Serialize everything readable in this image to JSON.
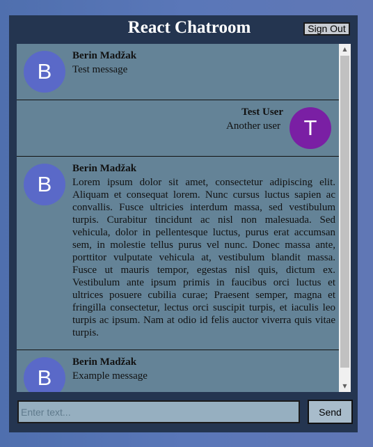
{
  "header": {
    "title": "React Chatroom",
    "signout_label": "Sign Out"
  },
  "messages": [
    {
      "initial": "B",
      "name": "Berin Madžak",
      "text": "Test message",
      "avatar_color": "#5a69c8",
      "side": "left"
    },
    {
      "initial": "T",
      "name": "Test User",
      "text": "Another user",
      "avatar_color": "#7a1fa4",
      "side": "right"
    },
    {
      "initial": "B",
      "name": "Berin Madžak",
      "text": "Lorem ipsum dolor sit amet, consectetur adipiscing elit. Aliquam et consequat lorem. Nunc cursus luctus sapien ac convallis. Fusce ultricies interdum massa, sed vestibulum turpis. Curabitur tincidunt ac nisl non malesuada. Sed vehicula, dolor in pellentesque luctus, purus erat accumsan sem, in molestie tellus purus vel nunc. Donec massa ante, porttitor vulputate vehicula at, vestibulum blandit massa. Fusce ut mauris tempor, egestas nisl quis, dictum ex. Vestibulum ante ipsum primis in faucibus orci luctus et ultrices posuere cubilia curae; Praesent semper, magna et fringilla consectetur, lectus orci suscipit turpis, et iaculis leo turpis ac ipsum. Nam at odio id felis auctor viverra quis vitae turpis.",
      "avatar_color": "#5a69c8",
      "side": "left"
    },
    {
      "initial": "B",
      "name": "Berin Madžak",
      "text": "Example message",
      "avatar_color": "#5a69c8",
      "side": "left"
    }
  ],
  "composer": {
    "placeholder": "Enter text...",
    "value": "",
    "send_label": "Send"
  },
  "colors": {
    "page_background": "#5a77b8",
    "panel": "#243550",
    "messages_area": "#648397",
    "input_background": "#96afc0"
  },
  "icons": {
    "scroll_up": "triangle-up-icon",
    "scroll_down": "triangle-down-icon"
  }
}
